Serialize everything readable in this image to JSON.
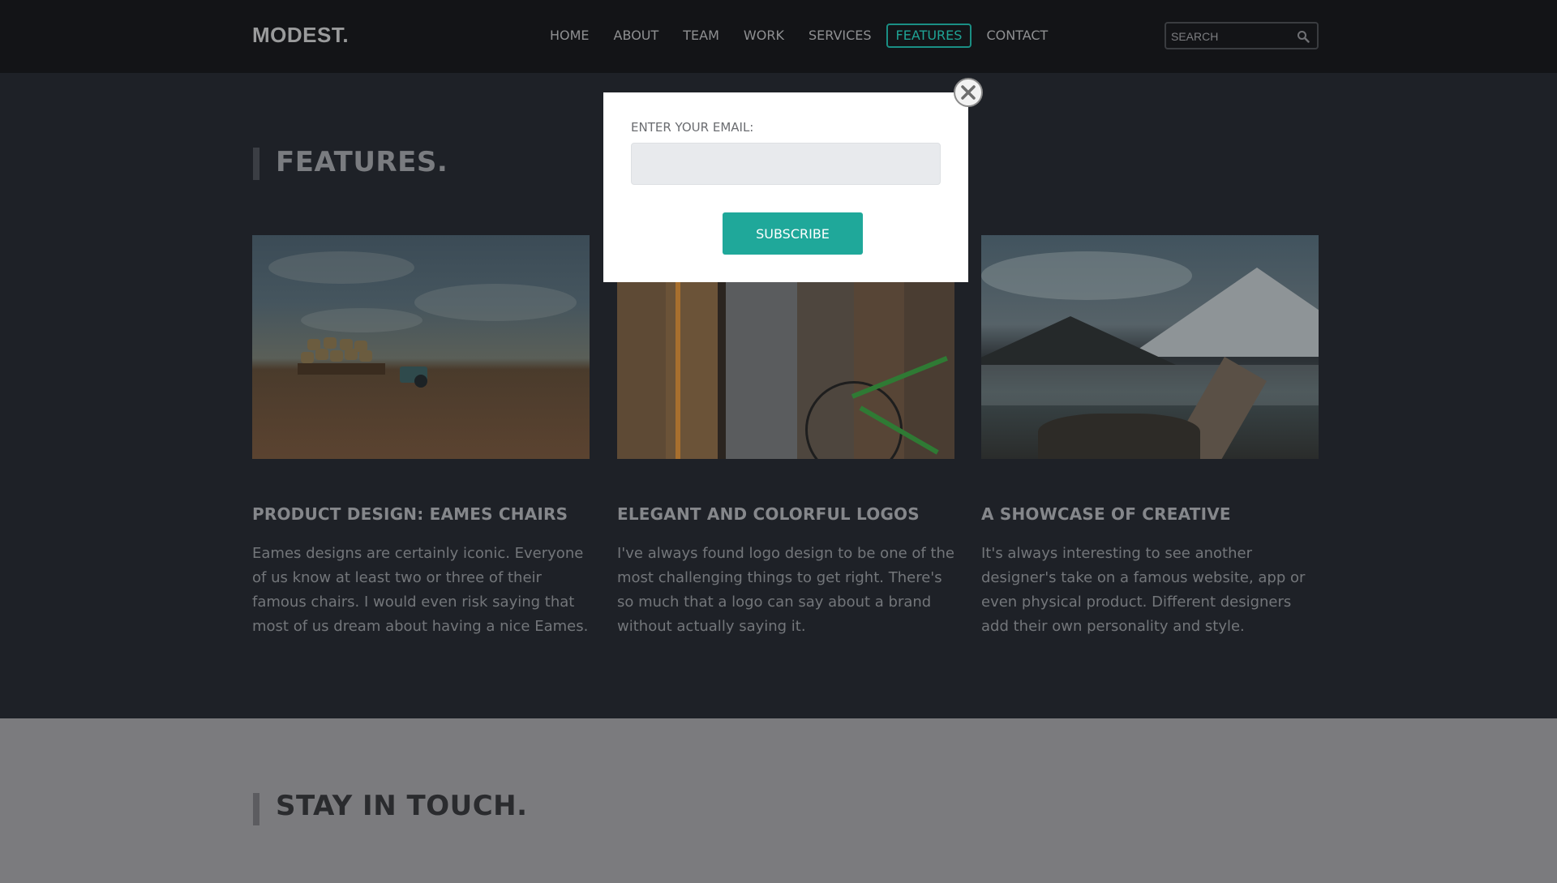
{
  "header": {
    "logo": "MODEST.",
    "nav": [
      {
        "label": "HOME"
      },
      {
        "label": "ABOUT"
      },
      {
        "label": "TEAM"
      },
      {
        "label": "WORK"
      },
      {
        "label": "SERVICES"
      },
      {
        "label": "FEATURES",
        "active": true
      },
      {
        "label": "CONTACT"
      }
    ],
    "search_placeholder": "SEARCH"
  },
  "features": {
    "title": "FEATURES.",
    "cards": [
      {
        "image": "field-with-tractor-and-hay-bales",
        "title": "PRODUCT DESIGN: EAMES CHAIRS",
        "text": "Eames designs are certainly iconic. Everyone of us know at least two or three of their famous chairs. I would even risk saying that most of us dream about having a nice Eames."
      },
      {
        "image": "old-wooden-door-with-green-bicycle",
        "title": "ELEGANT AND COLORFUL LOGOS",
        "text": "I've always found logo design to be one of the most challenging things to get right. There's so much that a logo can say about a brand without actually saying it."
      },
      {
        "image": "mountain-lake-with-boardwalk",
        "title": "A SHOWCASE OF CREATIVE",
        "text": "It's always interesting to see another designer's take on a famous website, app or even physical product. Different designers add their own personality and style."
      }
    ]
  },
  "touch": {
    "title": "STAY IN TOUCH."
  },
  "modal": {
    "label": "ENTER YOUR EMAIL:",
    "input_value": "",
    "button": "SUBSCRIBE",
    "close_icon": "close-icon"
  },
  "colors": {
    "accent": "#1fa89a",
    "header_bg": "#131417",
    "section_bg": "#1e2127",
    "touch_bg": "#7b7b7e"
  }
}
